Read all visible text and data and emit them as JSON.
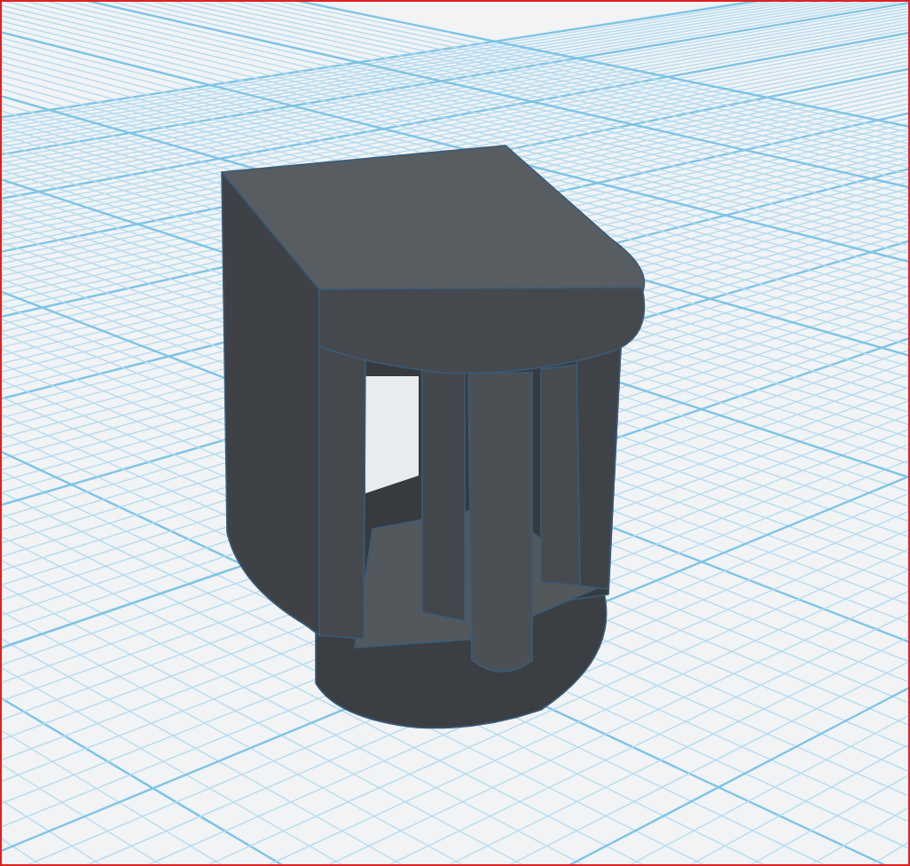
{
  "viewport": {
    "grid": true,
    "model": {
      "kind": "bracket"
    }
  }
}
